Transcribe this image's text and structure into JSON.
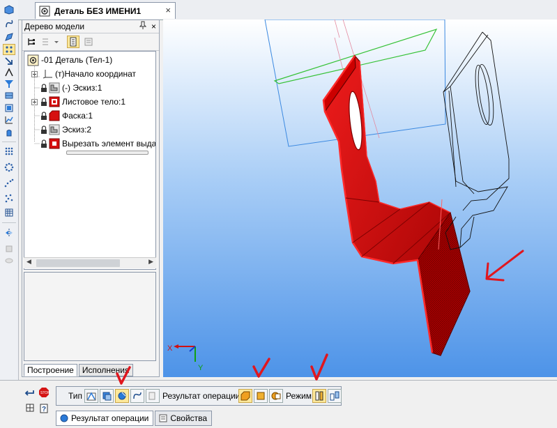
{
  "document_tab": {
    "title": "Деталь БЕЗ ИМЕНИ1",
    "close": "×"
  },
  "model_tree": {
    "title": "Дерево модели",
    "pin": "ᵖ",
    "close": "×",
    "nodes": [
      {
        "label": "-01 Деталь (Тел-1)"
      },
      {
        "label": "(т)Начало координат"
      },
      {
        "label": "(-) Эскиз:1"
      },
      {
        "label": "Листовое тело:1"
      },
      {
        "label": "Фаска:1"
      },
      {
        "label": "Эскиз:2"
      },
      {
        "label": "Вырезать элемент выда"
      }
    ],
    "tabs": [
      "Построение",
      "Исполнения"
    ]
  },
  "viewport": {
    "axis_x": "X",
    "axis_y": "Y"
  },
  "properties_panel": {
    "type_label": "Тип",
    "operation_result_label": "Результат операции",
    "mode_label": "Режим",
    "tabs": [
      "Результат операции",
      "Свойства"
    ],
    "stop_label": "STOP"
  },
  "colors": {
    "viewport_gradient_top": "#ffffff",
    "viewport_gradient_bottom": "#4d93e8",
    "part_red": "#cc0000",
    "selection_yellow": "#fde89a",
    "annotation_red": "#e0161e"
  }
}
